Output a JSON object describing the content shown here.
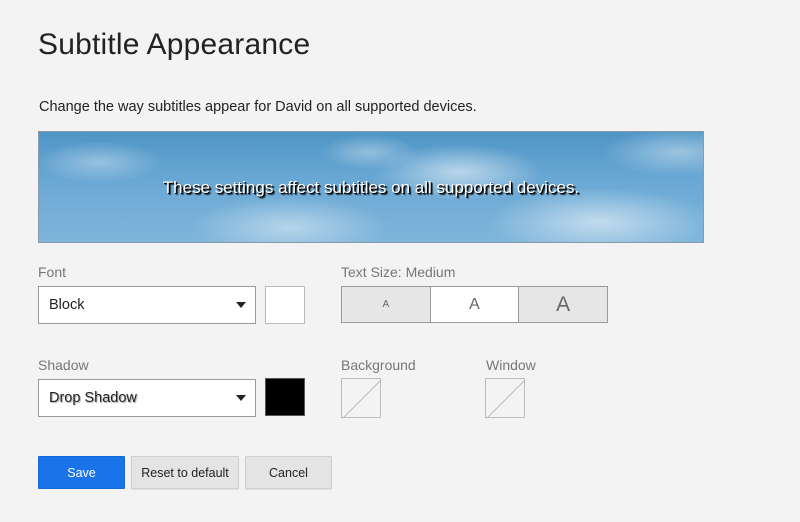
{
  "page": {
    "title": "Subtitle Appearance",
    "description": "Change the way subtitles appear for David on all supported devices."
  },
  "preview": {
    "text": "These settings affect subtitles on all supported devices."
  },
  "font": {
    "label": "Font",
    "selected": "Block",
    "color": "#ffffff"
  },
  "text_size": {
    "label": "Text Size: Medium",
    "options": [
      "A",
      "A",
      "A"
    ],
    "selected": "Medium"
  },
  "shadow": {
    "label": "Shadow",
    "selected": "Drop Shadow",
    "color": "#000000"
  },
  "background": {
    "label": "Background",
    "color": "none"
  },
  "window": {
    "label": "Window",
    "color": "none"
  },
  "actions": {
    "save": "Save",
    "reset": "Reset to default",
    "cancel": "Cancel"
  },
  "colors": {
    "primary": "#1a73e8",
    "page_background": "#f3f3f3"
  }
}
